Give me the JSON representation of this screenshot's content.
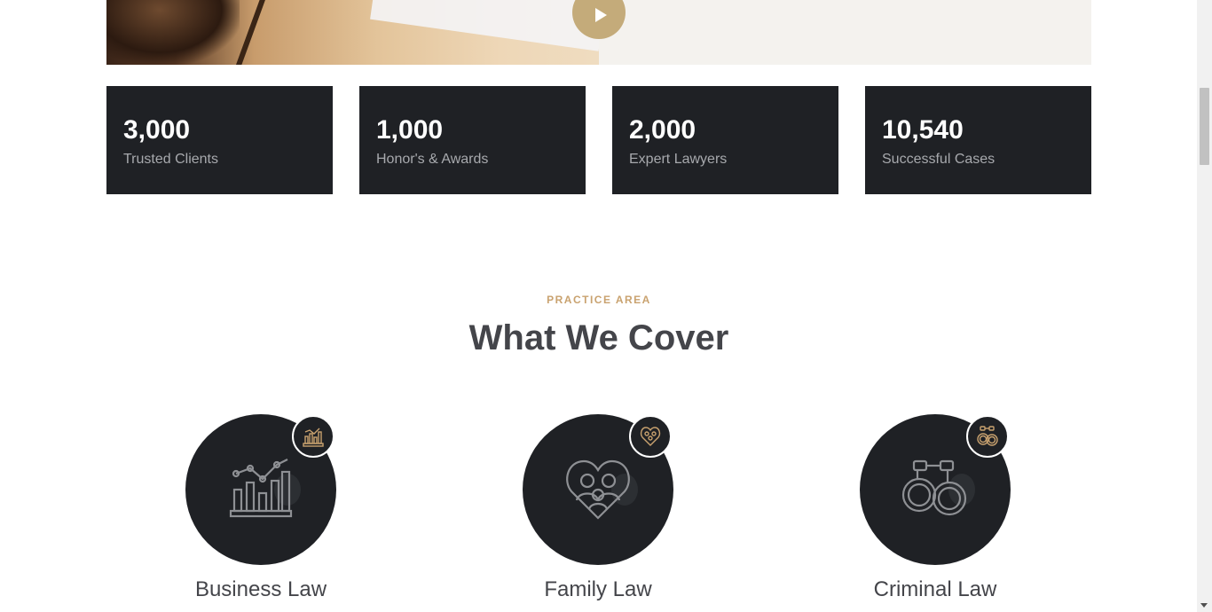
{
  "hero": {
    "play_icon": "play-icon"
  },
  "stats": [
    {
      "number": "3,000",
      "label": "Trusted Clients"
    },
    {
      "number": "1,000",
      "label": "Honor's & Awards"
    },
    {
      "number": "2,000",
      "label": "Expert Lawyers"
    },
    {
      "number": "10,540",
      "label": "Successful Cases"
    }
  ],
  "section": {
    "eyebrow": "PRACTICE AREA",
    "title": "What We Cover"
  },
  "areas": [
    {
      "title": "Business Law",
      "icon": "business-chart-icon"
    },
    {
      "title": "Family Law",
      "icon": "family-heart-icon"
    },
    {
      "title": "Criminal Law",
      "icon": "handcuffs-icon"
    }
  ],
  "colors": {
    "accent": "#c9a26f",
    "play_button": "#c4ab7a",
    "dark_card": "#1f2125",
    "heading": "#44454a"
  }
}
